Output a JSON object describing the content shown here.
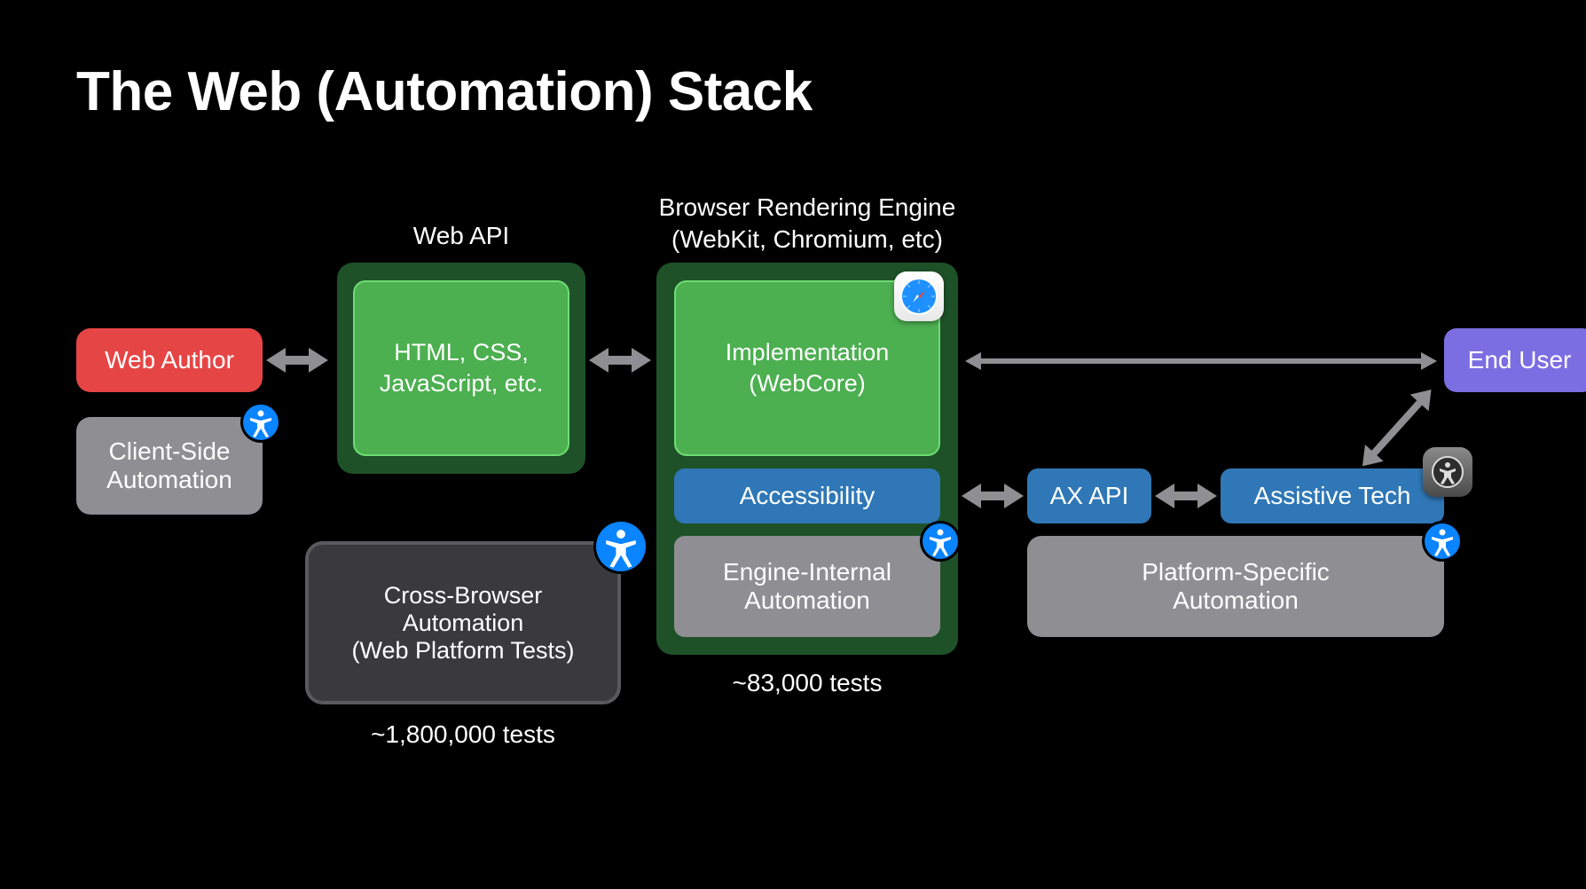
{
  "title": "The Web (Automation) Stack",
  "web_author": "Web Author",
  "client_side_automation": "Client-Side\nAutomation",
  "web_api_label": "Web API",
  "web_api_box": "HTML, CSS,\nJavaScript, etc.",
  "cross_browser_box": "Cross-Browser\nAutomation\n(Web Platform Tests)",
  "cross_browser_caption": "~1,800,000 tests",
  "engine_label": "Browser Rendering Engine\n(WebKit, Chromium, etc)",
  "impl_box": "Implementation\n(WebCore)",
  "accessibility_box": "Accessibility",
  "engine_internal_box": "Engine-Internal\nAutomation",
  "engine_caption": "~83,000 tests",
  "ax_api": "AX API",
  "assistive_tech": "Assistive Tech",
  "platform_specific": "Platform-Specific\nAutomation",
  "end_user": "End User",
  "icons": {
    "accessibility": "accessibility-icon",
    "safari": "safari-icon",
    "voiceover": "voiceover-icon"
  }
}
